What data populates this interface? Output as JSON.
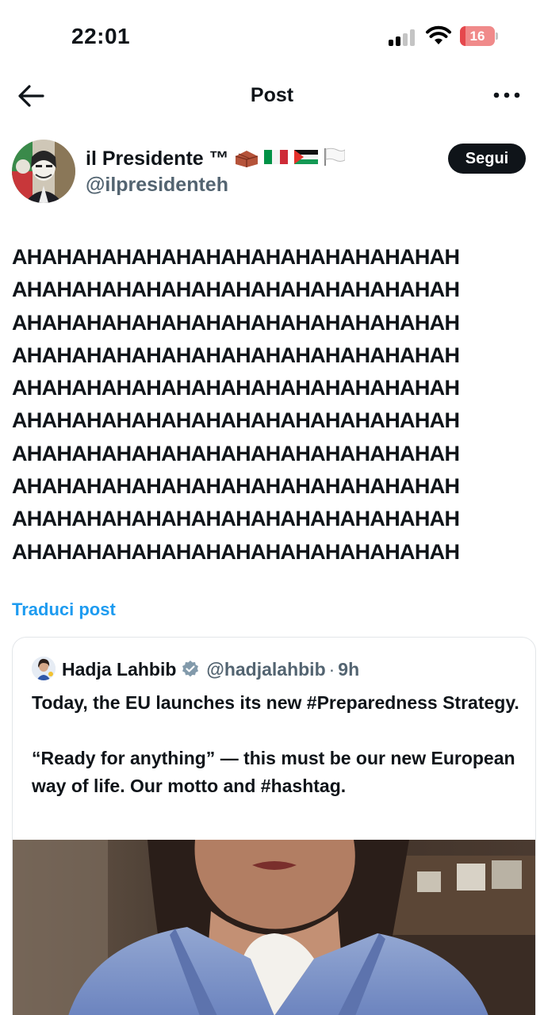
{
  "status_bar": {
    "time": "22:01",
    "battery_level": "16",
    "battery_fraction": 0.16,
    "icons": [
      "signal-icon",
      "wifi-icon",
      "battery-icon"
    ]
  },
  "nav": {
    "title": "Post",
    "back_icon": "arrow-left-icon",
    "more_icon": "ellipsis-icon"
  },
  "author": {
    "name": "il Presidente ™",
    "name_emojis": "🧱🇮🇹🇵🇸🏳️",
    "handle": "@ilpresidenteh",
    "follow_label": "Segui"
  },
  "post": {
    "lines": [
      "AHAHAHAHAHAHAHAHAHAHAHAHAHAHAH",
      "AHAHAHAHAHAHAHAHAHAHAHAHAHAHAH",
      "AHAHAHAHAHAHAHAHAHAHAHAHAHAHAH",
      "AHAHAHAHAHAHAHAHAHAHAHAHAHAHAH",
      "AHAHAHAHAHAHAHAHAHAHAHAHAHAHAH",
      "AHAHAHAHAHAHAHAHAHAHAHAHAHAHAH",
      "AHAHAHAHAHAHAHAHAHAHAHAHAHAHAH",
      "AHAHAHAHAHAHAHAHAHAHAHAHAHAHAH",
      "AHAHAHAHAHAHAHAHAHAHAHAHAHAHAH",
      "AHAHAHAHAHAHAHAHAHAHAHAHAHAHAH"
    ],
    "translate_label": "Traduci post"
  },
  "quote": {
    "name": "Hadja Lahbib",
    "handle": "@hadjalahbib",
    "separator": "·",
    "time": "9h",
    "verified_icon": "verified-badge-icon",
    "paragraph_1": "Today, the EU launches its new #Preparedness Strategy.",
    "paragraph_2": "“Ready for anything” — this must be our new European way of life. Our motto and #hashtag."
  },
  "colors": {
    "text": "#0f1419",
    "secondary": "#536471",
    "link": "#1d9bf0",
    "battery_low": "#e5484d",
    "border": "#e3e6e9"
  }
}
